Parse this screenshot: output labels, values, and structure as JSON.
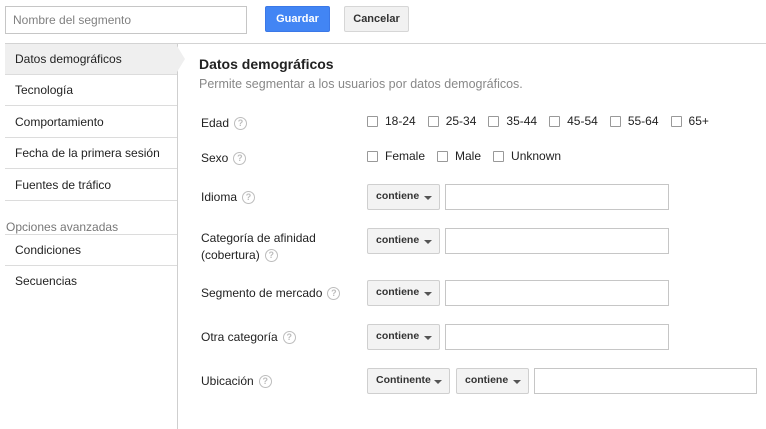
{
  "toolbar": {
    "segment_name_placeholder": "Nombre del segmento",
    "save_label": "Guardar",
    "cancel_label": "Cancelar",
    "accent_color": "#4285f4"
  },
  "sidebar": {
    "items": [
      {
        "label": "Datos demográficos",
        "active": true
      },
      {
        "label": "Tecnología"
      },
      {
        "label": "Comportamiento"
      },
      {
        "label": "Fecha de la primera sesión"
      },
      {
        "label": "Fuentes de tráfico"
      }
    ],
    "advanced_heading": "Opciones avanzadas",
    "advanced_items": [
      {
        "label": "Condiciones"
      },
      {
        "label": "Secuencias"
      }
    ]
  },
  "main": {
    "title": "Datos demográficos",
    "subtitle": "Permite segmentar a los usuarios por datos demográficos.",
    "help_glyph": "?",
    "age": {
      "label": "Edad",
      "options": [
        "18-24",
        "25-34",
        "35-44",
        "45-54",
        "55-64",
        "65+"
      ]
    },
    "sex": {
      "label": "Sexo",
      "options": [
        "Female",
        "Male",
        "Unknown"
      ]
    },
    "language": {
      "label": "Idioma",
      "operator": "contiene",
      "value": ""
    },
    "affinity": {
      "label_line1": "Categoría de afinidad",
      "label_line2": "(cobertura)",
      "operator": "contiene",
      "value": ""
    },
    "market": {
      "label": "Segmento de mercado",
      "operator": "contiene",
      "value": ""
    },
    "other": {
      "label": "Otra categoría",
      "operator": "contiene",
      "value": ""
    },
    "location": {
      "label": "Ubicación",
      "scope": "Continente",
      "operator": "contiene",
      "value": ""
    }
  }
}
